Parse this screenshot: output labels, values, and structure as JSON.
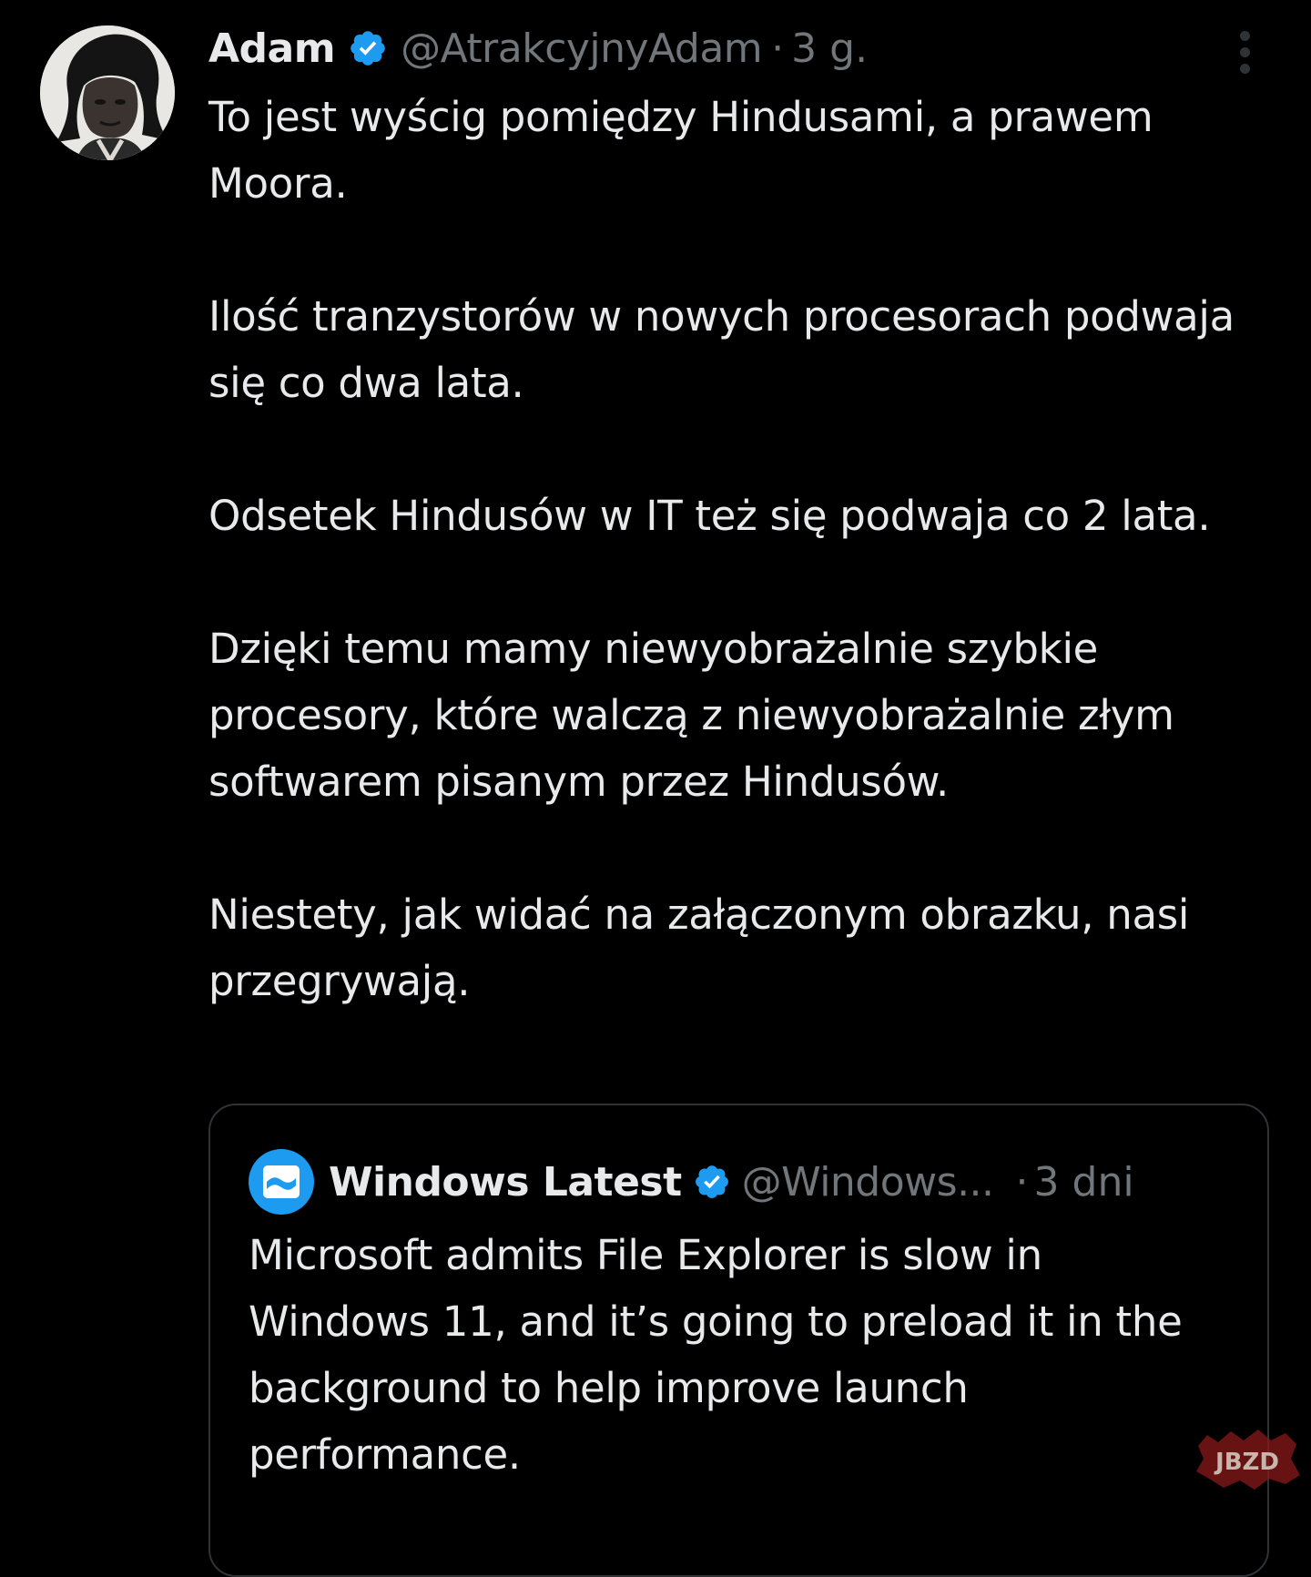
{
  "tweet": {
    "author": {
      "display_name": "Adam",
      "handle": "@AtrakcyjnyAdam",
      "separator": "·",
      "time": "3 g.",
      "verified": true,
      "avatar_icon": "profile-photo"
    },
    "paragraphs": [
      "To jest wyścig pomiędzy Hindusami, a prawem Moora.",
      "Ilość tranzystorów w nowych procesorach podwaja się co dwa lata.",
      "Odsetek Hindusów w IT też się podwaja co 2 lata.",
      "Dzięki temu mamy niewyobrażalnie szybkie procesory, które walczą z niewyobrażalnie złym softwarem pisanym przez Hindusów.",
      "Niestety, jak widać na załączonym obrazku, nasi przegrywają."
    ],
    "more_icon": "more-vertical-icon"
  },
  "quoted_tweet": {
    "author": {
      "display_name": "Windows Latest",
      "handle": "@Windows...",
      "separator": "·",
      "time": "3 dni",
      "verified": true,
      "avatar_icon": "windows-latest-logo"
    },
    "text": "Microsoft admits File Explorer is slow in Windows 11, and it’s going to preload it in the background to help improve launch performance."
  },
  "watermark": {
    "text": "JBZD"
  },
  "colors": {
    "background": "#000000",
    "primary_text": "#e7e9ea",
    "secondary_text": "#71767b",
    "verified_blue": "#1d9bf0",
    "border": "#2f3336",
    "watermark_red": "#8b1a1a"
  }
}
